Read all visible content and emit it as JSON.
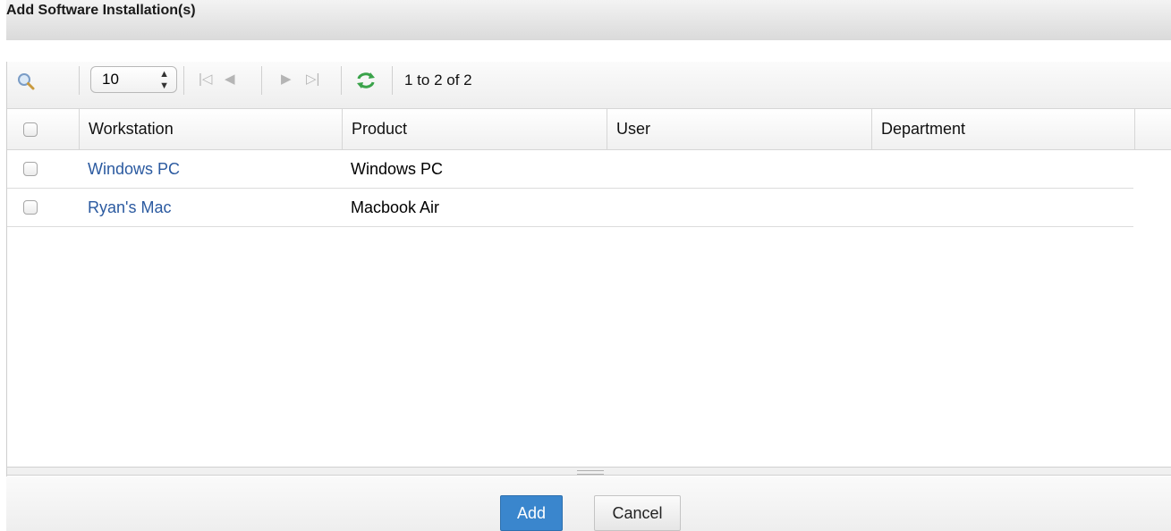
{
  "dialog": {
    "title": "Add Software Installation(s)"
  },
  "toolbar": {
    "search_icon": "search-icon",
    "page_size": "10",
    "range_text": "1 to 2 of 2",
    "icons": [
      "first-page-icon",
      "prev-page-icon",
      "next-page-icon",
      "last-page-icon",
      "refresh-icon"
    ]
  },
  "table": {
    "columns": [
      "Workstation",
      "Product",
      "User",
      "Department"
    ],
    "rows": [
      {
        "workstation": "Windows PC",
        "product": "Windows PC",
        "user": "",
        "department": ""
      },
      {
        "workstation": "Ryan's Mac",
        "product": "Macbook Air",
        "user": "",
        "department": ""
      }
    ]
  },
  "buttons": {
    "add": "Add",
    "cancel": "Cancel"
  },
  "colors": {
    "link": "#2b5aa0",
    "primary": "#3a86cd",
    "refresh_green": "#3aa34a"
  }
}
